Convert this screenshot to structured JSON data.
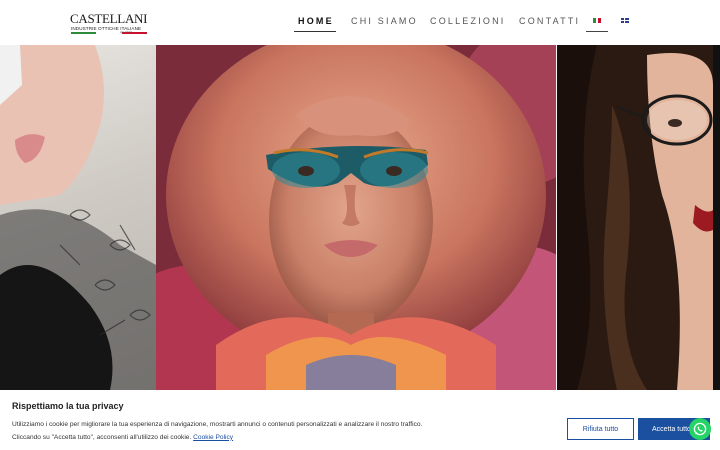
{
  "logo": {
    "name": "CASTELLANI",
    "subtitle": "INDUSTRIE OTTICHE ITALIANE",
    "established": "dal 1947"
  },
  "nav": {
    "items": [
      {
        "label": "HOME",
        "active": true
      },
      {
        "label": "CHI SIAMO",
        "active": false
      },
      {
        "label": "COLLEZIONI",
        "active": false
      },
      {
        "label": "CONTATTI",
        "active": false
      }
    ],
    "languages": [
      {
        "code": "it",
        "icon": "italy-flag-icon",
        "active": true
      },
      {
        "code": "en",
        "icon": "uk-flag-icon",
        "active": false
      }
    ]
  },
  "hero": {
    "panels": [
      "left-portrait-photo",
      "center-portrait-glasses-photo",
      "right-portrait-glasses-photo"
    ]
  },
  "cookie_banner": {
    "title": "Rispettiamo la tua privacy",
    "text_line1": "Utilizziamo i cookie per migliorare la tua esperienza di navigazione, mostrarti annunci o contenuti personalizzati e analizzare il nostro traffico.",
    "text_line2": "Cliccando su \"Accetta tutto\", acconsenti all'utilizzo dei cookie.",
    "policy_link": "Cookie Policy",
    "reject_label": "Rifiuta tutto",
    "accept_label": "Accetta tutto"
  },
  "chat_widget": {
    "icon": "whatsapp-icon"
  },
  "colors": {
    "accent": "#1b4fa0",
    "whatsapp": "#25d366",
    "flag_green": "#2e8b3a",
    "flag_red": "#c8102e"
  }
}
